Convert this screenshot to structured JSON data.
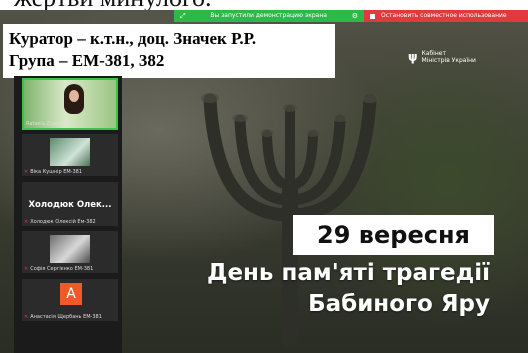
{
  "caption": {
    "text": "жертви минулого."
  },
  "share_bar": {
    "label": "Вы запустили демонстрацию экрана",
    "left_icon": "expand-icon",
    "right_icon": "gear-icon",
    "color": "#2db84a"
  },
  "stop_bar": {
    "label": "Остановить совместное использование",
    "icon": "stop-square-icon",
    "color": "#e0393e"
  },
  "curator": {
    "line1": "Куратор – к.т.н., доц. Значек Р.Р.",
    "line2": "Група – ЕМ-381, 382"
  },
  "ministry": {
    "line1": "Кабінет",
    "line2": "Міністрів України",
    "icon": "trident-icon"
  },
  "participants": {
    "tile1": {
      "name": "Rafaela Znachek"
    },
    "tile2": {
      "name": "Віка Кушнір ЕМ-381"
    },
    "speaker_name": "Холодюк Олек...",
    "tile3": {
      "name": "Холодюк Олексій Ем-382"
    },
    "tile4": {
      "name": "Софія Сергієнко ЕМ-381"
    },
    "tile5": {
      "name": "Анастасія Щербань ЕМ-381",
      "avatar_letter": "A",
      "avatar_color": "#f05a28"
    }
  },
  "slide": {
    "date": "29 вересня",
    "title_line1": "День пам'яті трагедії",
    "title_line2": "Бабиного Яру"
  }
}
